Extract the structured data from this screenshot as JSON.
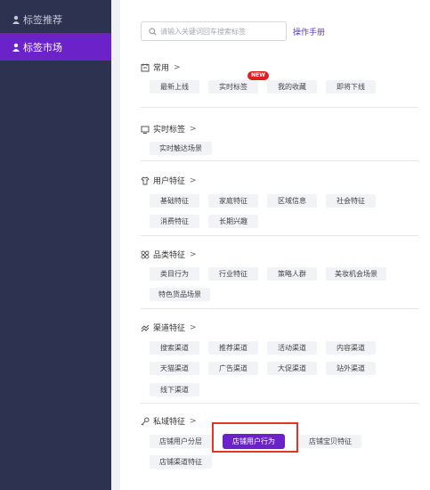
{
  "sidebar": {
    "items": [
      {
        "label": "标签推荐",
        "icon": "user-icon",
        "active": false
      },
      {
        "label": "标签市场",
        "icon": "user-icon",
        "active": true
      }
    ]
  },
  "search": {
    "placeholder": "请输入关键词回车搜索标签",
    "value": ""
  },
  "manual_link": "操作手册",
  "sections": {
    "common": {
      "title": "常用",
      "icon": "calendar-icon",
      "tags": [
        "最新上线",
        "实时标签",
        "我的收藏",
        "即将下线"
      ],
      "badge": "NEW"
    },
    "realtime": {
      "title": "实时标签",
      "icon": "monitor-icon",
      "tags": [
        "实时触达场景"
      ]
    },
    "user": {
      "title": "用户特征",
      "icon": "shirt-icon",
      "tags": [
        "基础特征",
        "家庭特征",
        "区域信息",
        "社会特征",
        "消费特征",
        "长期兴趣"
      ]
    },
    "category": {
      "title": "品类特征",
      "icon": "grid-icon",
      "tags": [
        "类目行为",
        "行业特征",
        "策略人群",
        "美妆机会场景",
        "特色货品场景"
      ]
    },
    "channel": {
      "title": "渠道特征",
      "icon": "flow-icon",
      "tags": [
        "搜索渠道",
        "推荐渠道",
        "活动渠道",
        "内容渠道",
        "天猫渠道",
        "广告渠道",
        "大促渠道",
        "站外渠道",
        "线下渠道"
      ]
    },
    "private": {
      "title": "私域特征",
      "icon": "key-icon",
      "tags": [
        "店铺用户分层",
        "店铺用户行为",
        "店铺宝贝特征",
        "店铺渠道特征"
      ],
      "selected_index": 1
    }
  },
  "colors": {
    "accent": "#6b22c9",
    "sidebar": "#2d3250",
    "highlight": "#e5332a",
    "badge": "#e02020"
  }
}
